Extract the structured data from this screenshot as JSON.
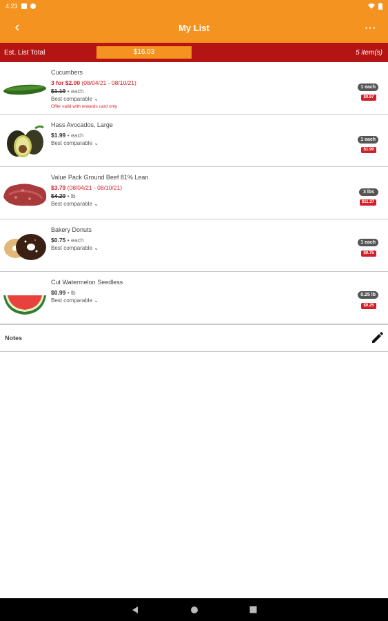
{
  "status_bar": {
    "time": "4:23"
  },
  "app_bar": {
    "title": "My List",
    "back_icon": "chevron-left-icon",
    "more_label": "···"
  },
  "total_bar": {
    "label": "Est. List Total",
    "total": "$16.03",
    "items": "5 item(s)"
  },
  "items": [
    {
      "name": "Cucumbers",
      "promo_price": "3 for $2.00",
      "promo_dates": "(08/04/21 - 08/10/21)",
      "price": "$1.19",
      "unit": "• each",
      "comparable": "Best comparable ⌄",
      "offer": "Offer valid with rewards card only",
      "qty": "1 each",
      "line_price": "$0.67"
    },
    {
      "name": "Hass Avocados, Large",
      "price": "$1.99",
      "unit": "• each",
      "comparable": "Best comparable ⌄",
      "qty": "1 each",
      "line_price": "$1.99"
    },
    {
      "name": "Value Pack Ground Beef 81% Lean",
      "promo_price": "$3.79",
      "promo_dates": "(08/04/21 - 08/10/21)",
      "price": "$4.29",
      "unit": "• lb",
      "comparable": "Best comparable ⌄",
      "qty": "3 lbs",
      "line_price": "$11.37"
    },
    {
      "name": "Bakery Donuts",
      "price": "$0.75",
      "unit": "• each",
      "comparable": "Best comparable ⌄",
      "qty": "1 each",
      "line_price": "$0.75"
    },
    {
      "name": "Cut Watermelon Seedless",
      "price": "$0.99",
      "unit": "• lb",
      "comparable": "Best comparable ⌄",
      "qty": "0.25 lb",
      "line_price": "$0.25"
    }
  ],
  "notes": {
    "label": "Notes",
    "edit_icon": "pencil-icon"
  },
  "colors": {
    "brand_orange": "#f4931f",
    "brand_red": "#b41413",
    "promo_red": "#d0202a"
  }
}
